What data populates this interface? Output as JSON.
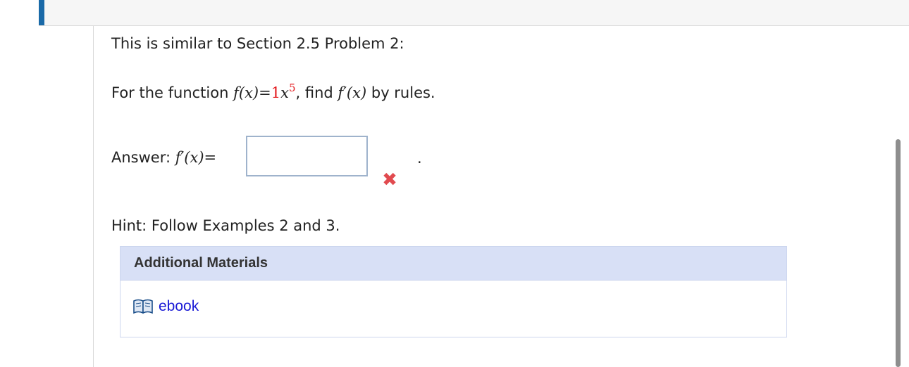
{
  "problem": {
    "intro": "This is similar to Section 2.5 Problem 2:",
    "question_prefix": "For the function",
    "function_lhs": "f(x)=",
    "coefficient": "1",
    "variable": "x",
    "exponent": "5",
    "question_mid": ", find",
    "derivative": "f′(x)",
    "question_suffix": "by rules."
  },
  "answer": {
    "label": "Answer:",
    "lhs": "f′(x)=",
    "value": "",
    "status_mark": "✖",
    "trailing": "."
  },
  "hint": "Hint: Follow Examples 2 and 3.",
  "materials": {
    "header": "Additional Materials",
    "link_label": "ebook",
    "link_icon": "book-icon"
  },
  "colors": {
    "accent": "#1a6aa8",
    "highlight": "#e3161b",
    "link": "#1a1ad6",
    "incorrect": "#e14a4f",
    "materials_header_bg": "#d8e0f6"
  }
}
